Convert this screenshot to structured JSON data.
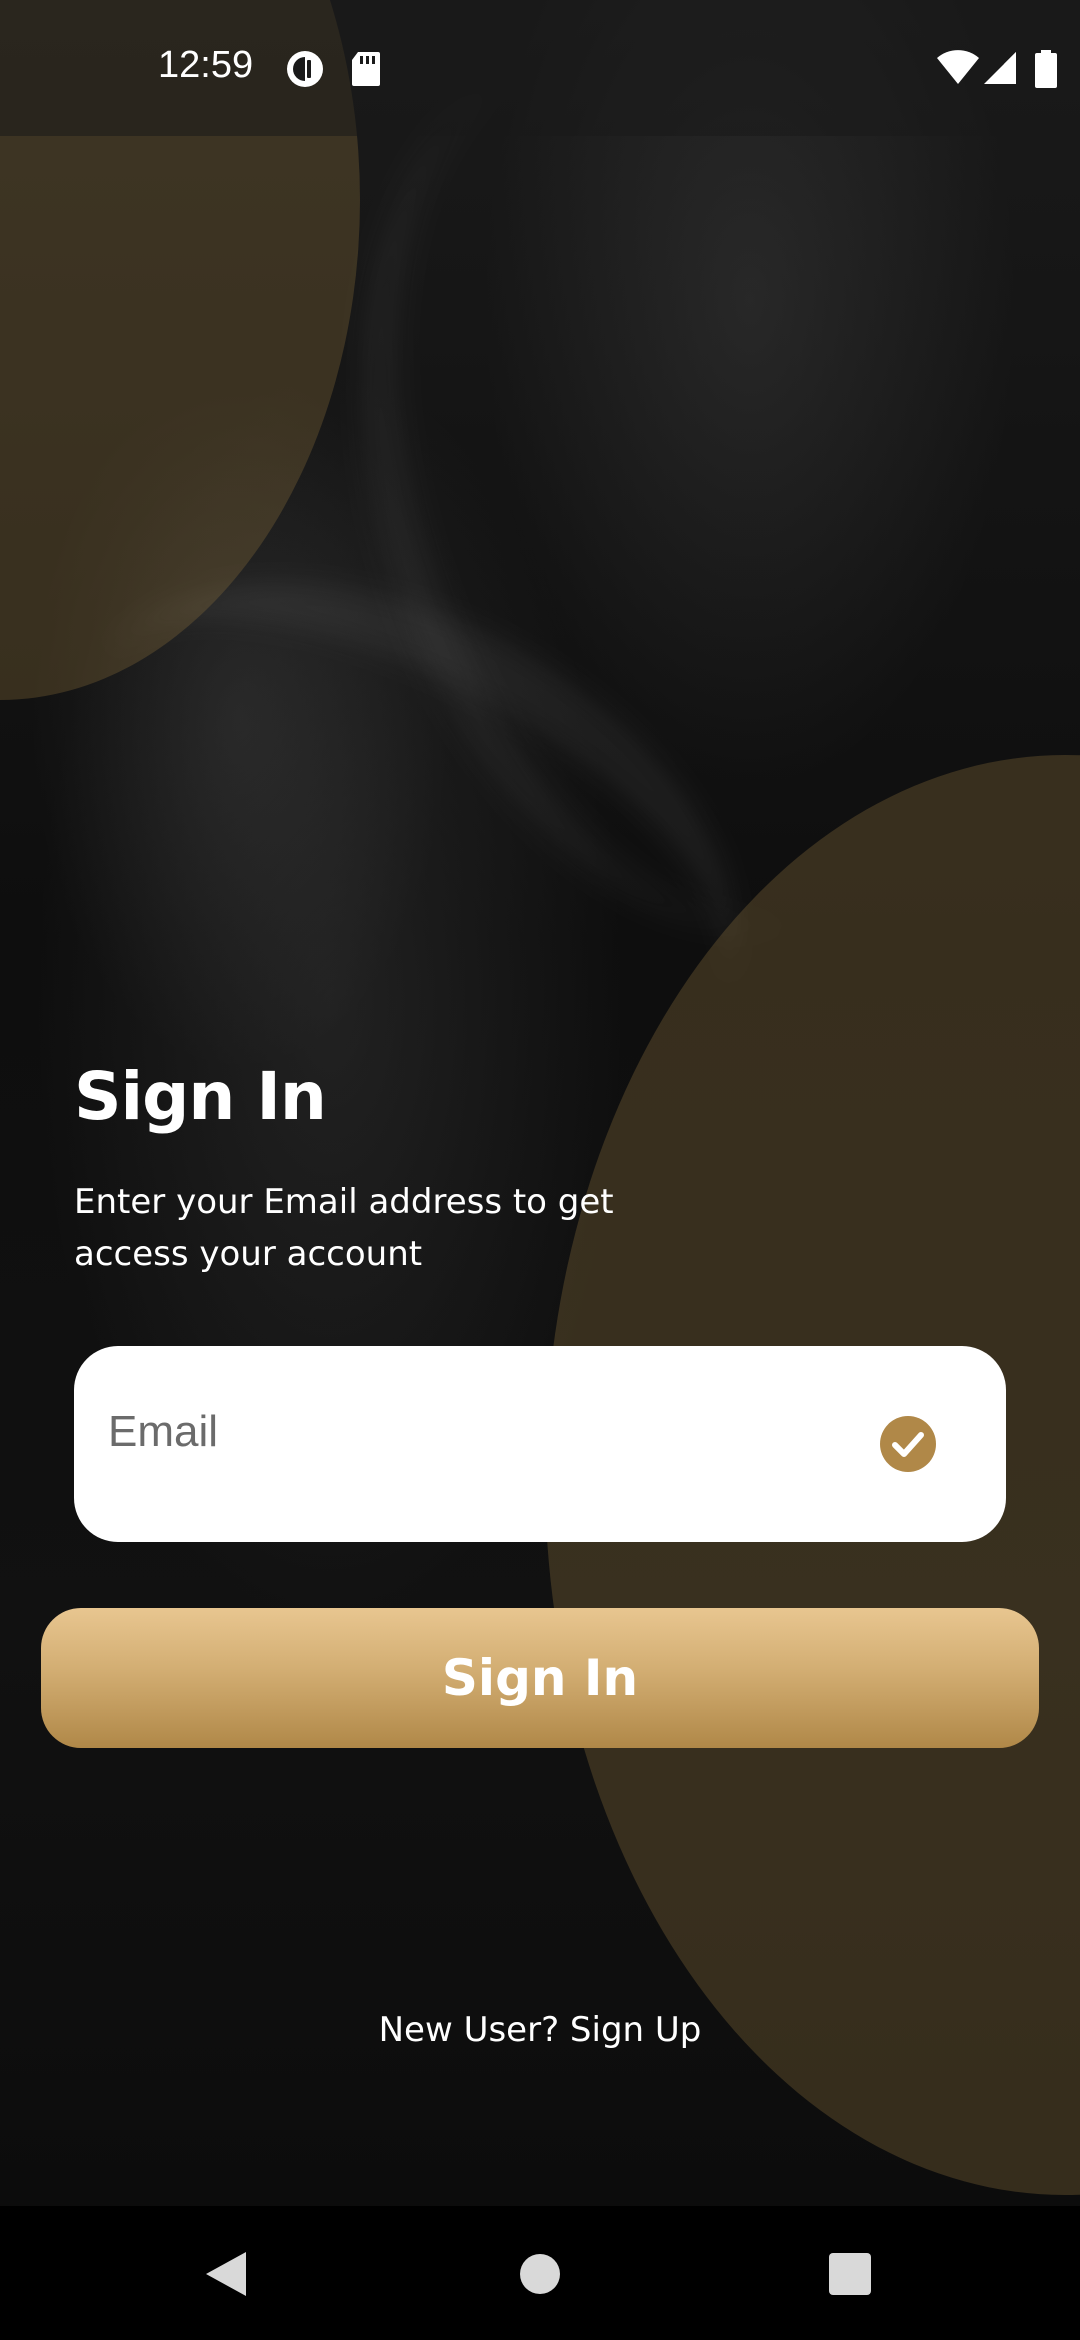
{
  "status_bar": {
    "time": "12:59",
    "left_icons": [
      "data-saver-icon",
      "sd-card-icon"
    ],
    "right_icons": [
      "wifi-icon",
      "signal-icon",
      "battery-icon"
    ]
  },
  "signin": {
    "title": "Sign In",
    "subtitle": "Enter your Email address to get access your account",
    "email_placeholder": "Email",
    "email_value": "",
    "button_label": "Sign In",
    "signup_link": "New User? Sign Up"
  },
  "nav_bar": {
    "buttons": [
      "back-icon",
      "home-icon",
      "recents-icon"
    ]
  },
  "colors": {
    "accent_gold": "#b08848",
    "check_gold": "#b08848",
    "background": "#0c0c0c"
  }
}
